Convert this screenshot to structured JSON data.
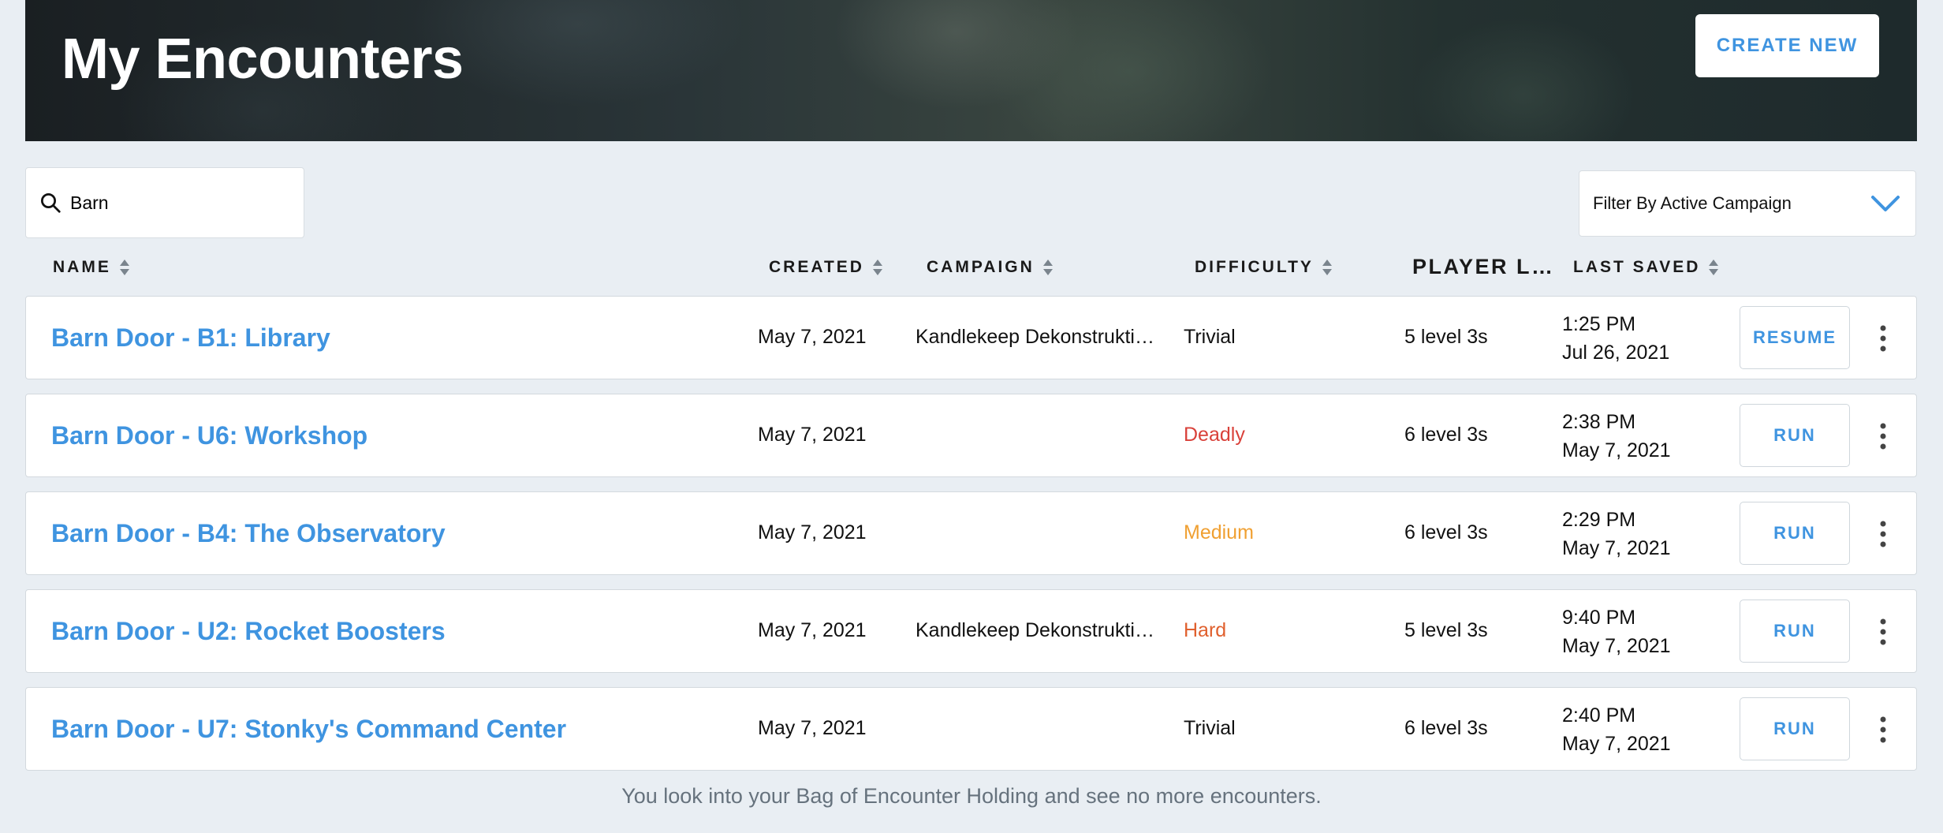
{
  "header": {
    "title": "My Encounters",
    "create_label": "CREATE NEW"
  },
  "search": {
    "value": "Barn",
    "icon": "search-icon"
  },
  "filter": {
    "label": "Filter By Active Campaign",
    "icon": "chevron-down-icon"
  },
  "columns": {
    "name": "NAME",
    "created": "CREATED",
    "campaign": "CAMPAIGN",
    "difficulty": "DIFFICULTY",
    "players": "PLAYER L…",
    "last_saved": "LAST SAVED"
  },
  "rows": [
    {
      "name": "Barn Door - B1: Library",
      "created": "May 7, 2021",
      "campaign": "Kandlekeep Dekonstrukti…",
      "difficulty": "Trivial",
      "players": "5 level 3s",
      "saved_time": "1:25 PM",
      "saved_date": "Jul 26, 2021",
      "action": "RESUME"
    },
    {
      "name": "Barn Door - U6: Workshop",
      "created": "May 7, 2021",
      "campaign": "",
      "difficulty": "Deadly",
      "players": "6 level 3s",
      "saved_time": "2:38 PM",
      "saved_date": "May 7, 2021",
      "action": "RUN"
    },
    {
      "name": "Barn Door - B4: The Observatory",
      "created": "May 7, 2021",
      "campaign": "",
      "difficulty": "Medium",
      "players": "6 level 3s",
      "saved_time": "2:29 PM",
      "saved_date": "May 7, 2021",
      "action": "RUN"
    },
    {
      "name": "Barn Door - U2: Rocket Boosters",
      "created": "May 7, 2021",
      "campaign": "Kandlekeep Dekonstrukti…",
      "difficulty": "Hard",
      "players": "5 level 3s",
      "saved_time": "9:40 PM",
      "saved_date": "May 7, 2021",
      "action": "RUN"
    },
    {
      "name": "Barn Door - U7: Stonky's Command Center",
      "created": "May 7, 2021",
      "campaign": "",
      "difficulty": "Trivial",
      "players": "6 level 3s",
      "saved_time": "2:40 PM",
      "saved_date": "May 7, 2021",
      "action": "RUN"
    }
  ],
  "footer": {
    "message": "You look into your Bag of Encounter Holding and see no more encounters."
  },
  "colors": {
    "accent": "#3f94e0",
    "deadly": "#d9413a",
    "medium": "#f0a032",
    "hard": "#e0602e",
    "trivial": "#111111",
    "background": "#e9eef3"
  }
}
